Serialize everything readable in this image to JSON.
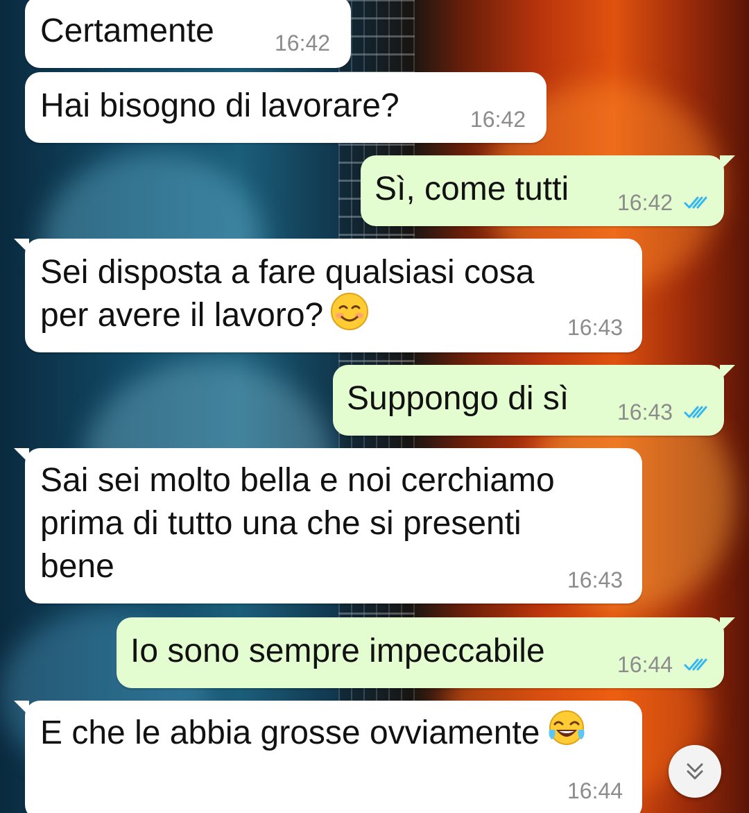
{
  "messages": [
    {
      "text": "Certamente",
      "time": "16:42"
    },
    {
      "text": "Hai bisogno di lavorare?",
      "time": "16:42"
    },
    {
      "text": "Sì, come tutti",
      "time": "16:42"
    },
    {
      "text": "Sei disposta a fare qualsiasi cosa\nper avere il lavoro?",
      "time": "16:43",
      "emoji": "smiling-face-emoji"
    },
    {
      "text": "Suppongo di sì",
      "time": "16:43"
    },
    {
      "text": "Sai sei molto bella e noi cerchiamo\nprima di tutto una che si presenti\nbene",
      "time": "16:43"
    },
    {
      "text": "Io sono sempre impeccabile",
      "time": "16:44"
    },
    {
      "text": "E che le abbia grosse ovviamente",
      "time": "16:44",
      "emoji": "tears-of-joy-emoji"
    }
  ],
  "colors": {
    "incoming_bubble": "#ffffff",
    "outgoing_bubble": "#e4fdd0",
    "read_ticks": "#34b7f1",
    "timestamp": "#8c8c8c"
  },
  "icons": {
    "read_receipt": "double-check-icon",
    "scroll_down": "double-chevron-down-icon"
  }
}
